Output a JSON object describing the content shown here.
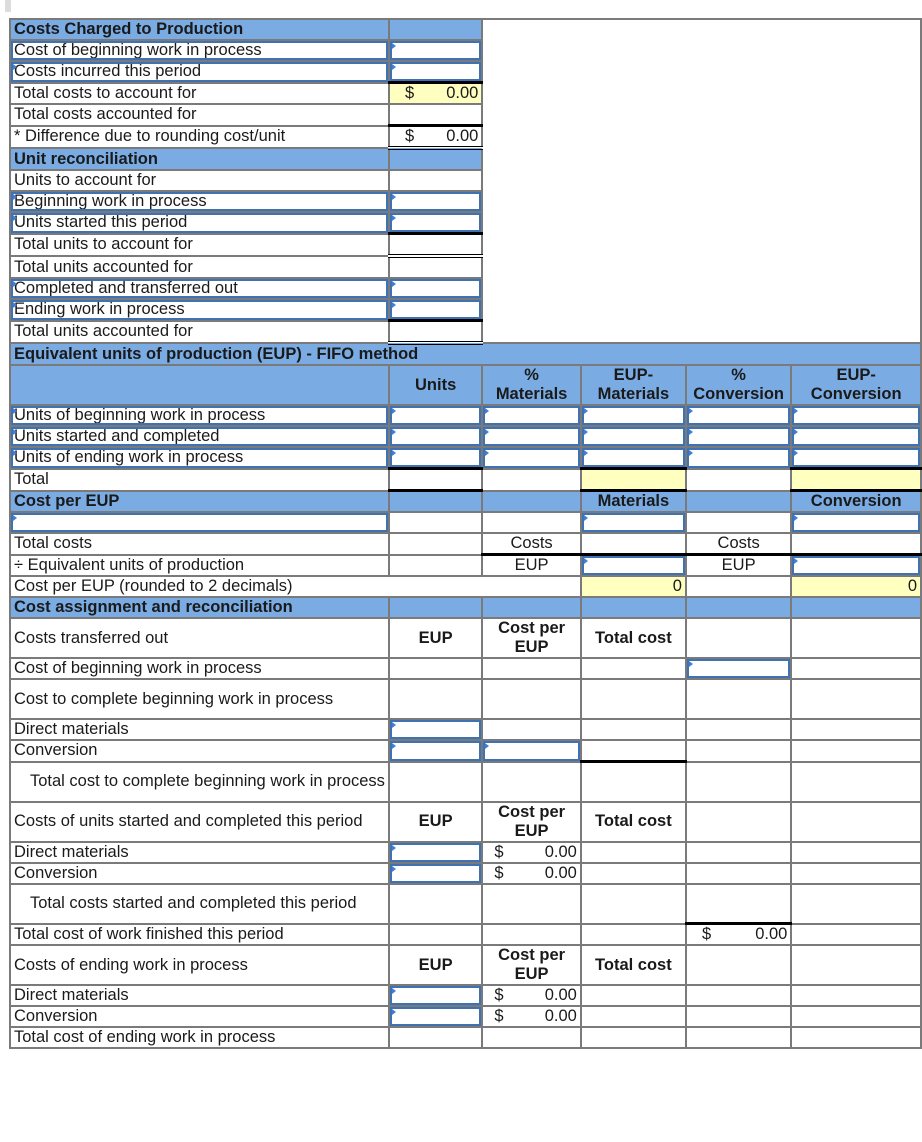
{
  "costs_charged": {
    "title": "Costs Charged to Production",
    "rows": [
      {
        "label": "Cost of beginning work in process",
        "value": ""
      },
      {
        "label": "Costs incurred this period",
        "value": ""
      },
      {
        "label": "Total costs to account for",
        "currency": "$",
        "value": "0.00"
      },
      {
        "label": "Total costs accounted for",
        "value": ""
      },
      {
        "label": "* Difference due to rounding cost/unit",
        "currency": "$",
        "value": "0.00"
      }
    ]
  },
  "unit_reconciliation": {
    "title": "Unit reconciliation",
    "rows": [
      {
        "label": "Units to account for"
      },
      {
        "label": "Beginning work in process",
        "value": ""
      },
      {
        "label": "Units started this period",
        "value": ""
      },
      {
        "label": "Total units to account for",
        "value": ""
      },
      {
        "label": "Total units accounted for"
      },
      {
        "label": "Completed and transferred out",
        "value": ""
      },
      {
        "label": "Ending work in process",
        "value": ""
      },
      {
        "label": "Total units accounted for",
        "value": ""
      }
    ]
  },
  "eup": {
    "title": "Equivalent units of production (EUP) - FIFO method",
    "columns": [
      "Units",
      "% Materials",
      "EUP-Materials",
      "% Conversion",
      "EUP-Conversion"
    ],
    "column_lines": [
      [
        "Units"
      ],
      [
        "%",
        "Materials"
      ],
      [
        "EUP-",
        "Materials"
      ],
      [
        "%",
        "Conversion"
      ],
      [
        "EUP-",
        "Conversion"
      ]
    ],
    "rows": [
      {
        "label": "Units of beginning work in process"
      },
      {
        "label": "Units started and completed"
      },
      {
        "label": "Units of ending work in process"
      },
      {
        "label": "Total"
      }
    ]
  },
  "cost_per_eup": {
    "title": "Cost per EUP",
    "materials_header": "Materials",
    "conversion_header": "Conversion",
    "total_costs_label": "Total costs",
    "divide_label": "÷ Equivalent units of production",
    "rounded_label": "Cost per EUP (rounded to 2 decimals)",
    "costs_label": "Costs",
    "eup_label": "EUP",
    "materials_result": "0",
    "conversion_result": "0"
  },
  "cost_assignment": {
    "title": "Cost assignment and reconciliation",
    "eup_header": "EUP",
    "cost_per_eup_header_lines": [
      "Cost per",
      "EUP"
    ],
    "total_cost_header": "Total cost",
    "transferred_out_label": "Costs transferred out",
    "beginning_wip_label": "Cost of beginning work in process",
    "cost_to_complete_label": "Cost to complete beginning work in process",
    "direct_materials_label": "Direct materials",
    "conversion_label": "Conversion",
    "total_cost_to_complete_label": "Total cost to complete beginning work in process",
    "started_completed_label": "Costs of units started and completed this period",
    "sc_direct_materials": {
      "currency": "$",
      "cost_per_eup": "0.00"
    },
    "sc_conversion": {
      "currency": "$",
      "cost_per_eup": "0.00"
    },
    "total_started_completed_label": "Total costs started and completed this period",
    "total_finished_label": "Total cost of work finished this period",
    "total_finished": {
      "currency": "$",
      "value": "0.00"
    },
    "ending_wip_label": "Costs of ending work in process",
    "ew_direct_materials": {
      "currency": "$",
      "cost_per_eup": "0.00"
    },
    "ew_conversion": {
      "currency": "$",
      "cost_per_eup": "0.00"
    },
    "total_ending_wip_label": "Total cost of ending work in process"
  }
}
